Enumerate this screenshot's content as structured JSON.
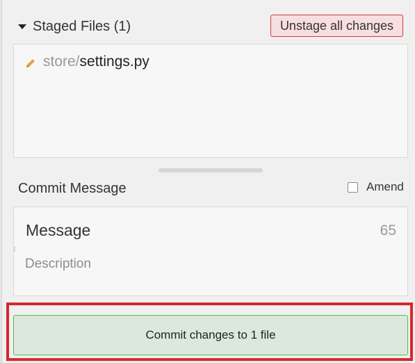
{
  "staged": {
    "title": "Staged Files (1)",
    "unstage_label": "Unstage all changes",
    "files": [
      {
        "dir": "store/",
        "name": "settings.py",
        "icon": "pencil-icon"
      }
    ]
  },
  "commit": {
    "label": "Commit Message",
    "amend_label": "Amend",
    "message_placeholder": "Message",
    "char_count": "65",
    "description_placeholder": "Description",
    "button_label": "Commit changes to 1 file"
  },
  "colors": {
    "unstage_border": "#d9363e",
    "unstage_bg": "#f8dede",
    "commit_border": "#56b55c",
    "commit_bg": "#dde8dc",
    "highlight": "#d42a2a",
    "pencil": "#e8a33a"
  }
}
